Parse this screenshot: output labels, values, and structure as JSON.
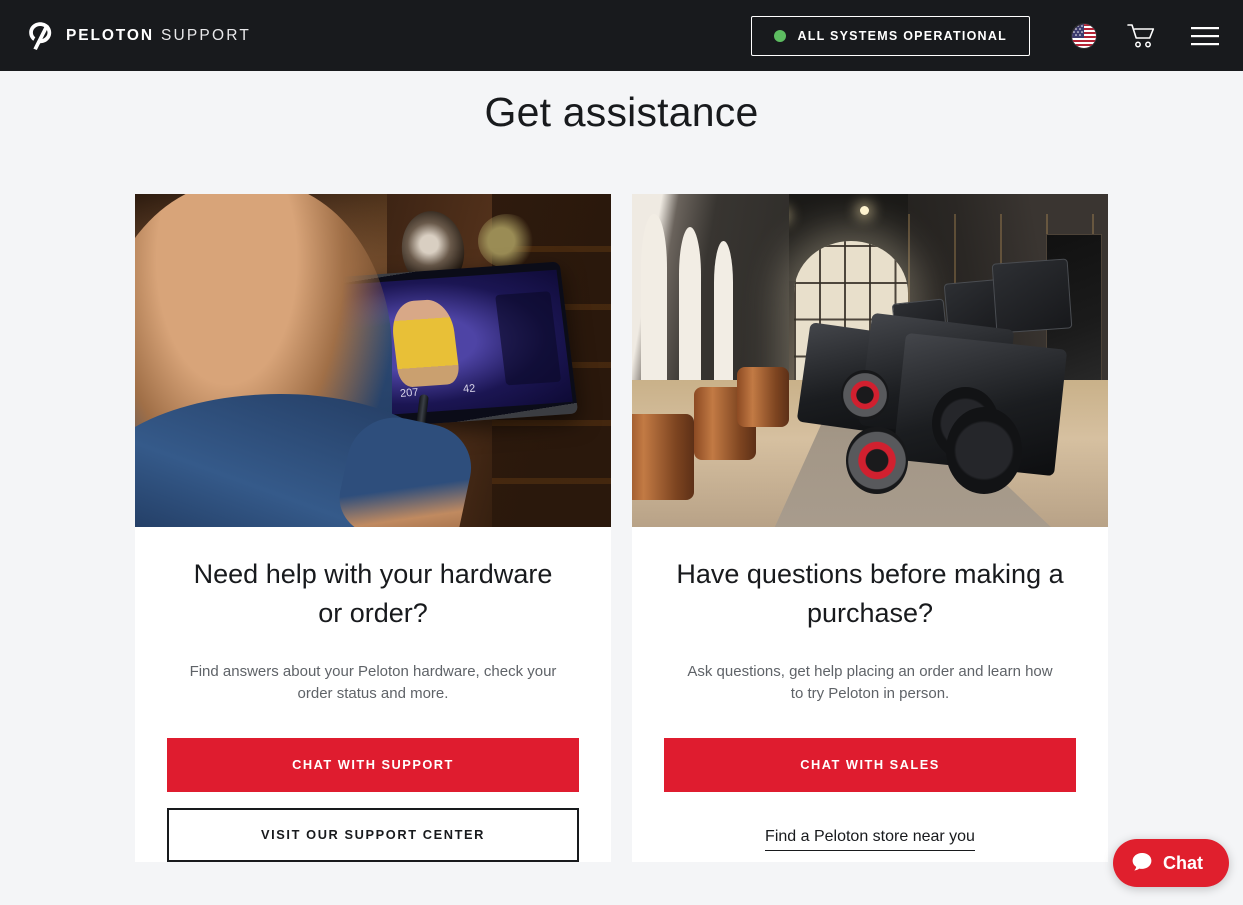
{
  "header": {
    "brand_name": "PELOTON",
    "brand_sub": "SUPPORT",
    "logo_icon": "peloton-p-logo-icon",
    "status": {
      "label": "ALL SYSTEMS OPERATIONAL",
      "dot_color": "#5dbd61",
      "dot_icon": "status-dot-icon"
    },
    "locale_icon": "us-flag-icon",
    "cart_icon": "shopping-cart-icon",
    "menu_icon": "hamburger-menu-icon",
    "background_color": "#181a1d"
  },
  "page": {
    "title": "Get assistance",
    "background_color": "#f4f5f7",
    "accent_color": "#df1c2f"
  },
  "cards": [
    {
      "image_alt": "Man riding a Peloton Bike at home watching an instructor on the screen",
      "title": "Need help with your hardware or order?",
      "description": "Find answers about your Peloton hardware, check your order status and more.",
      "primary_button": "CHAT WITH SUPPORT",
      "secondary_button": "VISIT OUR SUPPORT CENTER"
    },
    {
      "image_alt": "Peloton showroom hallway with a row of Peloton Bikes",
      "title": "Have questions before making a purchase?",
      "description": "Ask questions, get help placing an order and learn how to try Peloton in person.",
      "primary_button": "CHAT WITH SALES",
      "link": "Find a Peloton store near you"
    }
  ],
  "chat_widget": {
    "label": "Chat",
    "icon": "chat-bubble-icon",
    "color": "#e01f2d"
  }
}
